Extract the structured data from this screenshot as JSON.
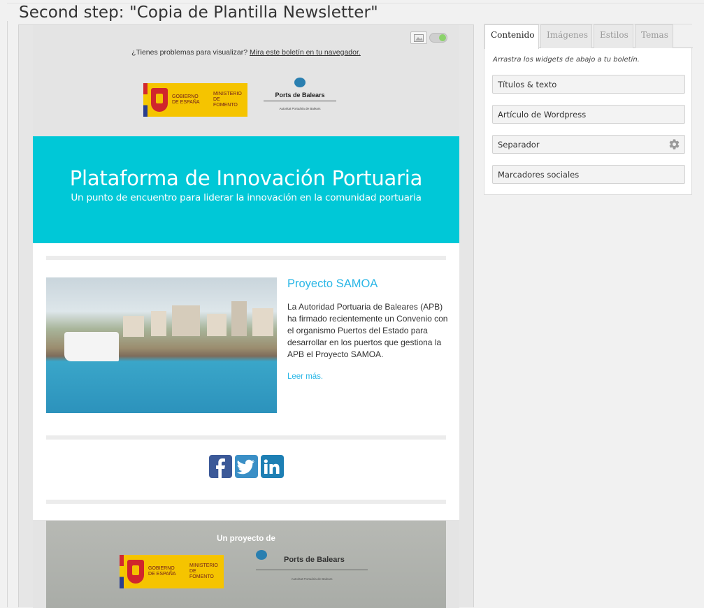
{
  "page": {
    "title": "Second step: \"Copia de Plantilla Newsletter\""
  },
  "newsletter": {
    "view_online_prefix": "¿Tienes problemas para visualizar? ",
    "view_online_link": "Mira este boletín en tu navegador.",
    "gov_logo": {
      "line1": "Gobierno de España",
      "line2": "Ministerio de Fomento"
    },
    "ports_logo": {
      "name": "Ports de Balears",
      "sub": "Autoritat Portuària de Balears"
    },
    "hero": {
      "title": "Plataforma de Innovación Portuaria",
      "subtitle": "Un punto de encuentro para liderar la innovación en la comunidad portuaria",
      "bg_color": "#00c8d7"
    },
    "article": {
      "title": "Proyecto SAMOA",
      "body": "La Autoridad Portuaria de Baleares (APB) ha firmado recientemente un Convenio con el organismo Puertos del Estado para desarrollar en los puertos que gestiona la APB el Proyecto SAMOA.",
      "read_more": "Leer más.",
      "link_color": "#29b6e6"
    },
    "social": [
      {
        "name": "facebook-icon",
        "glyph": "f"
      },
      {
        "name": "twitter-icon",
        "glyph": "t"
      },
      {
        "name": "linkedin-icon",
        "glyph": "in"
      }
    ],
    "footer": {
      "label": "Un proyecto de"
    }
  },
  "panel": {
    "tabs": [
      {
        "label": "Contenido",
        "active": true
      },
      {
        "label": "Imágenes",
        "active": false
      },
      {
        "label": "Estilos",
        "active": false
      },
      {
        "label": "Temas",
        "active": false
      }
    ],
    "hint": "Arrastra los widgets de abajo a tu boletín.",
    "widgets": [
      {
        "label": "Títulos & texto"
      },
      {
        "label": "Artículo de Wordpress"
      },
      {
        "label": "Separador",
        "icon": "gear-icon"
      },
      {
        "label": "Marcadores sociales"
      }
    ]
  }
}
